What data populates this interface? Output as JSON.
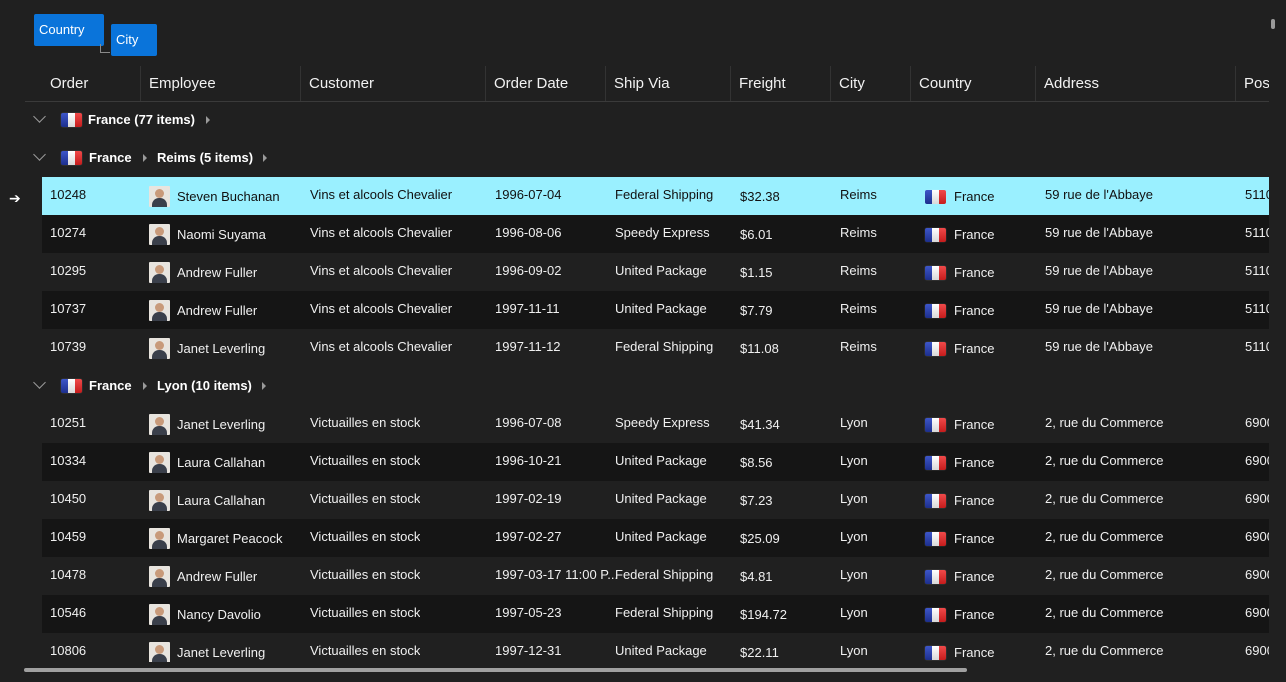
{
  "grouping_panel": {
    "chips": [
      "Country",
      "City"
    ]
  },
  "columns": [
    "Order",
    "Employee",
    "Customer",
    "Order Date",
    "Ship Via",
    "Freight",
    "City",
    "Country",
    "Address",
    "Pos"
  ],
  "groups": [
    {
      "label": "France (77 items)",
      "level": 1
    },
    {
      "parent": "France",
      "label": "Reims (5 items)",
      "level": 2,
      "rows": [
        {
          "order": "10248",
          "employee": "Steven Buchanan",
          "customer": "Vins et alcools Chevalier",
          "date": "1996-07-04",
          "ship": "Federal Shipping",
          "freight": "$32.38",
          "city": "Reims",
          "country": "France",
          "address": "59 rue de l'Abbaye",
          "postal": "5110",
          "selected": true
        },
        {
          "order": "10274",
          "employee": "Naomi Suyama",
          "customer": "Vins et alcools Chevalier",
          "date": "1996-08-06",
          "ship": "Speedy Express",
          "freight": "$6.01",
          "city": "Reims",
          "country": "France",
          "address": "59 rue de l'Abbaye",
          "postal": "5110"
        },
        {
          "order": "10295",
          "employee": "Andrew Fuller",
          "customer": "Vins et alcools Chevalier",
          "date": "1996-09-02",
          "ship": "United Package",
          "freight": "$1.15",
          "city": "Reims",
          "country": "France",
          "address": "59 rue de l'Abbaye",
          "postal": "5110"
        },
        {
          "order": "10737",
          "employee": "Andrew Fuller",
          "customer": "Vins et alcools Chevalier",
          "date": "1997-11-11",
          "ship": "United Package",
          "freight": "$7.79",
          "city": "Reims",
          "country": "France",
          "address": "59 rue de l'Abbaye",
          "postal": "5110"
        },
        {
          "order": "10739",
          "employee": "Janet Leverling",
          "customer": "Vins et alcools Chevalier",
          "date": "1997-11-12",
          "ship": "Federal Shipping",
          "freight": "$11.08",
          "city": "Reims",
          "country": "France",
          "address": "59 rue de l'Abbaye",
          "postal": "5110"
        }
      ]
    },
    {
      "parent": "France",
      "label": "Lyon (10 items)",
      "level": 2,
      "rows": [
        {
          "order": "10251",
          "employee": "Janet Leverling",
          "customer": "Victuailles en stock",
          "date": "1996-07-08",
          "ship": "Speedy Express",
          "freight": "$41.34",
          "city": "Lyon",
          "country": "France",
          "address": "2, rue du Commerce",
          "postal": "6900"
        },
        {
          "order": "10334",
          "employee": "Laura Callahan",
          "customer": "Victuailles en stock",
          "date": "1996-10-21",
          "ship": "United Package",
          "freight": "$8.56",
          "city": "Lyon",
          "country": "France",
          "address": "2, rue du Commerce",
          "postal": "6900"
        },
        {
          "order": "10450",
          "employee": "Laura Callahan",
          "customer": "Victuailles en stock",
          "date": "1997-02-19",
          "ship": "United Package",
          "freight": "$7.23",
          "city": "Lyon",
          "country": "France",
          "address": "2, rue du Commerce",
          "postal": "6900"
        },
        {
          "order": "10459",
          "employee": "Margaret Peacock",
          "customer": "Victuailles en stock",
          "date": "1997-02-27",
          "ship": "United Package",
          "freight": "$25.09",
          "city": "Lyon",
          "country": "France",
          "address": "2, rue du Commerce",
          "postal": "6900"
        },
        {
          "order": "10478",
          "employee": "Andrew Fuller",
          "customer": "Victuailles en stock",
          "date": "1997-03-17 11:00 P...",
          "ship": "Federal Shipping",
          "freight": "$4.81",
          "city": "Lyon",
          "country": "France",
          "address": "2, rue du Commerce",
          "postal": "6900"
        },
        {
          "order": "10546",
          "employee": "Nancy Davolio",
          "customer": "Victuailles en stock",
          "date": "1997-05-23",
          "ship": "Federal Shipping",
          "freight": "$194.72",
          "city": "Lyon",
          "country": "France",
          "address": "2, rue du Commerce",
          "postal": "6900"
        },
        {
          "order": "10806",
          "employee": "Janet Leverling",
          "customer": "Victuailles en stock",
          "date": "1997-12-31",
          "ship": "United Package",
          "freight": "$22.11",
          "city": "Lyon",
          "country": "France",
          "address": "2, rue du Commerce",
          "postal": "6900"
        }
      ]
    }
  ],
  "row_indicator": "➔"
}
